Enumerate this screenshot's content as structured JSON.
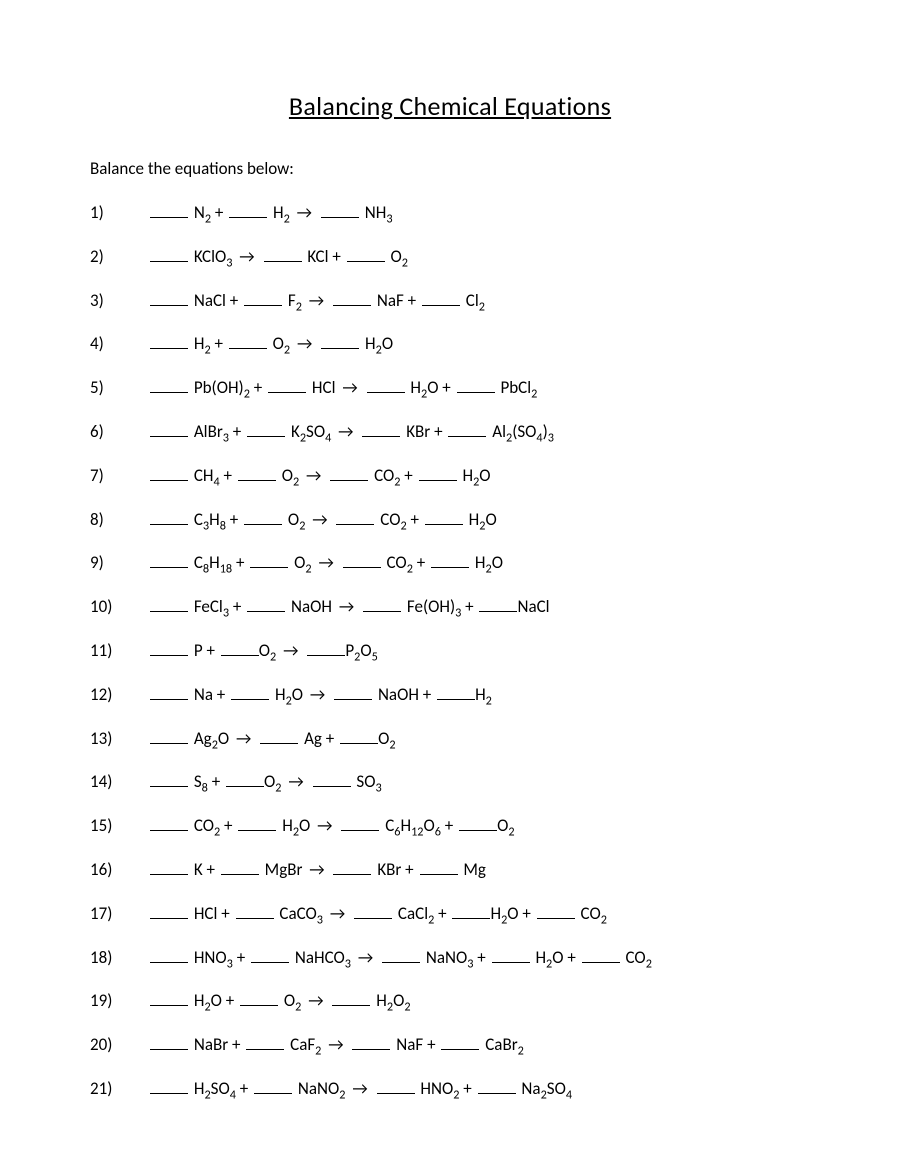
{
  "title": "Balancing Chemical Equations",
  "instructions": "Balance the equations below:",
  "arrow": "→",
  "equations": [
    [
      [
        "blank"
      ],
      " N",
      [
        "sub",
        "2"
      ],
      " + ",
      [
        "blank"
      ],
      " H",
      [
        "sub",
        "2"
      ],
      " ",
      [
        "arrow"
      ],
      " ",
      [
        "blank"
      ],
      " NH",
      [
        "sub",
        "3"
      ]
    ],
    [
      [
        "blank"
      ],
      " KClO",
      [
        "sub",
        "3"
      ],
      " ",
      [
        "arrow"
      ],
      " ",
      [
        "blank"
      ],
      " KCl + ",
      [
        "blank"
      ],
      " O",
      [
        "sub",
        "2"
      ]
    ],
    [
      [
        "blank"
      ],
      " NaCl + ",
      [
        "blank"
      ],
      " F",
      [
        "sub",
        "2"
      ],
      " ",
      [
        "arrow"
      ],
      " ",
      [
        "blank"
      ],
      " NaF + ",
      [
        "blank"
      ],
      " Cl",
      [
        "sub",
        "2"
      ]
    ],
    [
      [
        "blank"
      ],
      " H",
      [
        "sub",
        "2"
      ],
      " + ",
      [
        "blank"
      ],
      " O",
      [
        "sub",
        "2"
      ],
      " ",
      [
        "arrow"
      ],
      " ",
      [
        "blank"
      ],
      " H",
      [
        "sub",
        "2"
      ],
      "O"
    ],
    [
      [
        "blank"
      ],
      " Pb(OH)",
      [
        "sub",
        "2"
      ],
      " + ",
      [
        "blank"
      ],
      " HCl ",
      [
        "arrow"
      ],
      " ",
      [
        "blank"
      ],
      " H",
      [
        "sub",
        "2"
      ],
      "O + ",
      [
        "blank"
      ],
      " PbCl",
      [
        "sub",
        "2"
      ]
    ],
    [
      [
        "blank"
      ],
      " AlBr",
      [
        "sub",
        "3"
      ],
      " + ",
      [
        "blank"
      ],
      " K",
      [
        "sub",
        "2"
      ],
      "SO",
      [
        "sub",
        "4"
      ],
      " ",
      [
        "arrow"
      ],
      " ",
      [
        "blank"
      ],
      " KBr + ",
      [
        "blank"
      ],
      " Al",
      [
        "sub",
        "2"
      ],
      "(SO",
      [
        "sub",
        "4"
      ],
      ")",
      [
        "sub",
        "3"
      ]
    ],
    [
      [
        "blank"
      ],
      " CH",
      [
        "sub",
        "4"
      ],
      " + ",
      [
        "blank"
      ],
      " O",
      [
        "sub",
        "2"
      ],
      " ",
      [
        "arrow"
      ],
      " ",
      [
        "blank"
      ],
      " CO",
      [
        "sub",
        "2"
      ],
      " + ",
      [
        "blank"
      ],
      " H",
      [
        "sub",
        "2"
      ],
      "O"
    ],
    [
      [
        "blank"
      ],
      " C",
      [
        "sub",
        "3"
      ],
      "H",
      [
        "sub",
        "8"
      ],
      " + ",
      [
        "blank"
      ],
      " O",
      [
        "sub",
        "2"
      ],
      " ",
      [
        "arrow"
      ],
      " ",
      [
        "blank"
      ],
      " CO",
      [
        "sub",
        "2"
      ],
      " + ",
      [
        "blank"
      ],
      " H",
      [
        "sub",
        "2"
      ],
      "O"
    ],
    [
      [
        "blank"
      ],
      " C",
      [
        "sub",
        "8"
      ],
      "H",
      [
        "sub",
        "18"
      ],
      " + ",
      [
        "blank"
      ],
      " O",
      [
        "sub",
        "2"
      ],
      " ",
      [
        "arrow"
      ],
      " ",
      [
        "blank"
      ],
      " CO",
      [
        "sub",
        "2"
      ],
      " + ",
      [
        "blank"
      ],
      " H",
      [
        "sub",
        "2"
      ],
      "O"
    ],
    [
      [
        "blank"
      ],
      " FeCl",
      [
        "sub",
        "3"
      ],
      " + ",
      [
        "blank"
      ],
      " NaOH ",
      [
        "arrow"
      ],
      " ",
      [
        "blank"
      ],
      " Fe(OH)",
      [
        "sub",
        "3"
      ],
      " + ",
      [
        "blankt"
      ],
      "NaCl"
    ],
    [
      [
        "blank"
      ],
      " P + ",
      [
        "blankt"
      ],
      "O",
      [
        "sub",
        "2"
      ],
      " ",
      [
        "arrow"
      ],
      " ",
      [
        "blankt"
      ],
      "P",
      [
        "sub",
        "2"
      ],
      "O",
      [
        "sub",
        "5"
      ]
    ],
    [
      [
        "blank"
      ],
      " Na + ",
      [
        "blank"
      ],
      " H",
      [
        "sub",
        "2"
      ],
      "O ",
      [
        "arrow"
      ],
      " ",
      [
        "blank"
      ],
      " NaOH + ",
      [
        "blankt"
      ],
      "H",
      [
        "sub",
        "2"
      ]
    ],
    [
      [
        "blank"
      ],
      " Ag",
      [
        "sub",
        "2"
      ],
      "O ",
      [
        "arrow"
      ],
      " ",
      [
        "blank"
      ],
      " Ag + ",
      [
        "blankt"
      ],
      "O",
      [
        "sub",
        "2"
      ]
    ],
    [
      [
        "blank"
      ],
      " S",
      [
        "sub",
        "8"
      ],
      " + ",
      [
        "blankt"
      ],
      "O",
      [
        "sub",
        "2"
      ],
      " ",
      [
        "arrow"
      ],
      " ",
      [
        "blank"
      ],
      " SO",
      [
        "sub",
        "3"
      ]
    ],
    [
      [
        "blank"
      ],
      " CO",
      [
        "sub",
        "2"
      ],
      " + ",
      [
        "blank"
      ],
      " H",
      [
        "sub",
        "2"
      ],
      "O ",
      [
        "arrow"
      ],
      " ",
      [
        "blank"
      ],
      " C",
      [
        "sub",
        "6"
      ],
      "H",
      [
        "sub",
        "12"
      ],
      "O",
      [
        "sub",
        "6"
      ],
      " + ",
      [
        "blankt"
      ],
      "O",
      [
        "sub",
        "2"
      ]
    ],
    [
      [
        "blank"
      ],
      " K + ",
      [
        "blank"
      ],
      " MgBr ",
      [
        "arrow"
      ],
      " ",
      [
        "blank"
      ],
      " KBr + ",
      [
        "blank"
      ],
      " Mg"
    ],
    [
      [
        "blank"
      ],
      " HCl + ",
      [
        "blank"
      ],
      " CaCO",
      [
        "sub",
        "3"
      ],
      " ",
      [
        "arrow"
      ],
      " ",
      [
        "blank"
      ],
      " CaCl",
      [
        "sub",
        "2"
      ],
      " + ",
      [
        "blankt"
      ],
      "H",
      [
        "sub",
        "2"
      ],
      "O + ",
      [
        "blank"
      ],
      " CO",
      [
        "sub",
        "2"
      ]
    ],
    [
      [
        "blank"
      ],
      " HNO",
      [
        "sub",
        "3"
      ],
      " + ",
      [
        "blank"
      ],
      " NaHCO",
      [
        "sub",
        "3"
      ],
      " ",
      [
        "arrow"
      ],
      " ",
      [
        "blank"
      ],
      " NaNO",
      [
        "sub",
        "3"
      ],
      " + ",
      [
        "blank"
      ],
      " H",
      [
        "sub",
        "2"
      ],
      "O + ",
      [
        "blank"
      ],
      " CO",
      [
        "sub",
        "2"
      ]
    ],
    [
      [
        "blank"
      ],
      " H",
      [
        "sub",
        "2"
      ],
      "O + ",
      [
        "blank"
      ],
      " O",
      [
        "sub",
        "2"
      ],
      " ",
      [
        "arrow"
      ],
      " ",
      [
        "blank"
      ],
      " H",
      [
        "sub",
        "2"
      ],
      "O",
      [
        "sub",
        "2"
      ]
    ],
    [
      [
        "blank"
      ],
      " NaBr + ",
      [
        "blank"
      ],
      " CaF",
      [
        "sub",
        "2"
      ],
      " ",
      [
        "arrow"
      ],
      " ",
      [
        "blank"
      ],
      " NaF + ",
      [
        "blank"
      ],
      " CaBr",
      [
        "sub",
        "2"
      ]
    ],
    [
      [
        "blank"
      ],
      " H",
      [
        "sub",
        "2"
      ],
      "SO",
      [
        "sub",
        "4"
      ],
      " + ",
      [
        "blank"
      ],
      " NaNO",
      [
        "sub",
        "2"
      ],
      " ",
      [
        "arrow"
      ],
      " ",
      [
        "blank"
      ],
      " HNO",
      [
        "sub",
        "2"
      ],
      " + ",
      [
        "blank"
      ],
      " Na",
      [
        "sub",
        "2"
      ],
      "SO",
      [
        "sub",
        "4"
      ]
    ]
  ]
}
